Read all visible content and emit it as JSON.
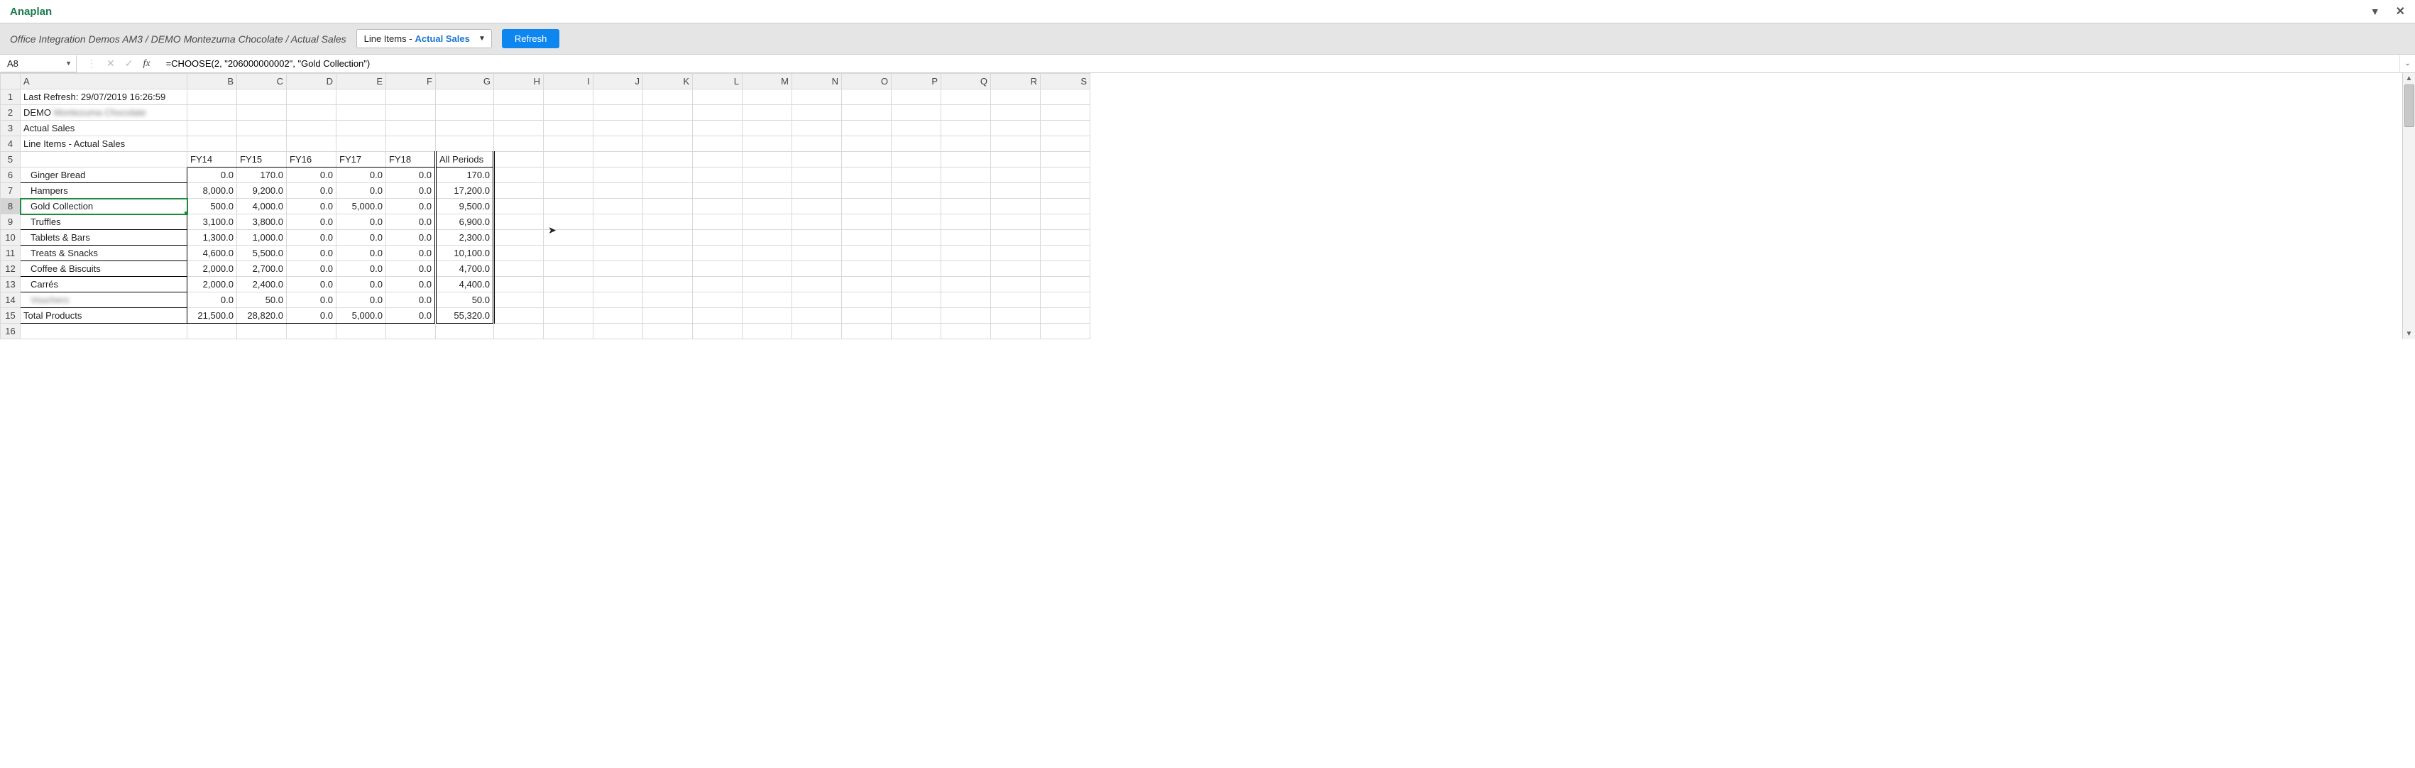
{
  "app_title": "Anaplan",
  "breadcrumb": "Office Integration Demos AM3 / DEMO Montezuma Chocolate / Actual Sales",
  "page_selector": {
    "label": "Line Items - ",
    "value": "Actual Sales"
  },
  "refresh_label": "Refresh",
  "namebox": "A8",
  "formula": "=CHOOSE(2, \"206000000002\", \"Gold Collection\")",
  "columns": [
    "A",
    "B",
    "C",
    "D",
    "E",
    "F",
    "G",
    "H",
    "I",
    "J",
    "K",
    "L",
    "M",
    "N",
    "O",
    "P",
    "Q",
    "R",
    "S"
  ],
  "meta_rows": {
    "r1": "Last Refresh: 29/07/2019 16:26:59",
    "r2_prefix": "DEMO",
    "r2_blur": "Montezuma Chocolate",
    "r3": "Actual Sales",
    "r4": "Line Items - Actual Sales"
  },
  "headers": [
    "FY14",
    "FY15",
    "FY16",
    "FY17",
    "FY18",
    "All Periods"
  ],
  "rows": [
    {
      "label": "Ginger Bread",
      "vals": [
        "0.0",
        "170.0",
        "0.0",
        "0.0",
        "0.0",
        "170.0"
      ]
    },
    {
      "label": "Hampers",
      "vals": [
        "8,000.0",
        "9,200.0",
        "0.0",
        "0.0",
        "0.0",
        "17,200.0"
      ]
    },
    {
      "label": "Gold Collection",
      "vals": [
        "500.0",
        "4,000.0",
        "0.0",
        "5,000.0",
        "0.0",
        "9,500.0"
      ],
      "selected": true
    },
    {
      "label": "Truffles",
      "vals": [
        "3,100.0",
        "3,800.0",
        "0.0",
        "0.0",
        "0.0",
        "6,900.0"
      ]
    },
    {
      "label": "Tablets & Bars",
      "vals": [
        "1,300.0",
        "1,000.0",
        "0.0",
        "0.0",
        "0.0",
        "2,300.0"
      ]
    },
    {
      "label": "Treats & Snacks",
      "vals": [
        "4,600.0",
        "5,500.0",
        "0.0",
        "0.0",
        "0.0",
        "10,100.0"
      ]
    },
    {
      "label": "Coffee & Biscuits",
      "vals": [
        "2,000.0",
        "2,700.0",
        "0.0",
        "0.0",
        "0.0",
        "4,700.0"
      ]
    },
    {
      "label": "Carrés",
      "vals": [
        "2,000.0",
        "2,400.0",
        "0.0",
        "0.0",
        "0.0",
        "4,400.0"
      ]
    },
    {
      "label": "",
      "blur": "Vouchers",
      "vals": [
        "0.0",
        "50.0",
        "0.0",
        "0.0",
        "0.0",
        "50.0"
      ]
    }
  ],
  "total": {
    "label": "Total Products",
    "vals": [
      "21,500.0",
      "28,820.0",
      "0.0",
      "5,000.0",
      "0.0",
      "55,320.0"
    ]
  }
}
